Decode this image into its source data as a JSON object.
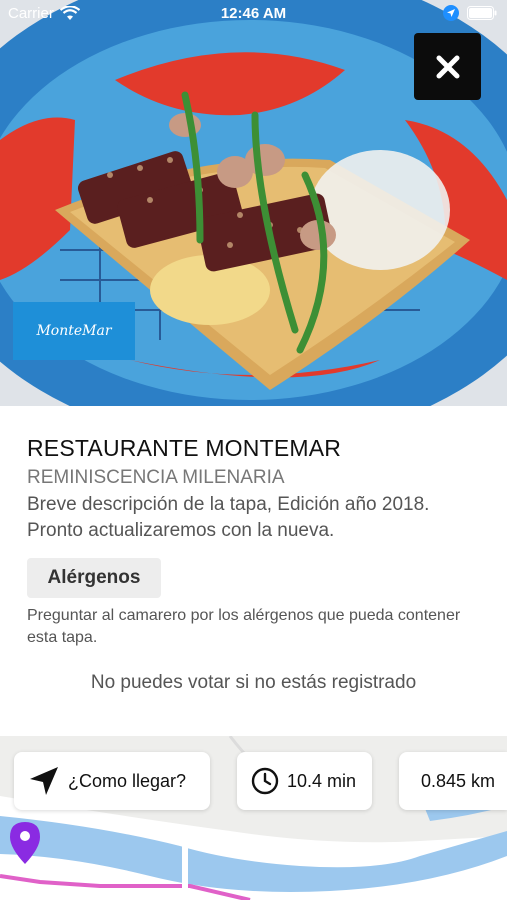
{
  "status_bar": {
    "carrier": "Carrier",
    "time": "12:46 AM"
  },
  "logo_text": "MonteMar",
  "restaurant_name": "RESTAURANTE MONTEMAR",
  "tapa_name": "REMINISCENCIA MILENARIA",
  "description": "Breve descripción de la tapa, Edición año 2018. Pronto actualizaremos con la nueva.",
  "allergens": {
    "button_label": "Alérgenos",
    "note": "Preguntar al camarero por los alérgenos que pueda contener esta tapa."
  },
  "vote_message": "No puedes votar si no estás registrado",
  "actions": {
    "directions_label": "¿Como llegar?",
    "time_label": "10.4 min",
    "distance_label": "0.845 km"
  },
  "icons": [
    "wifi-icon",
    "location-arrow-icon",
    "battery-icon",
    "close-icon",
    "navigation-arrow-icon",
    "clock-icon",
    "route-icon",
    "map-pin-icon"
  ]
}
